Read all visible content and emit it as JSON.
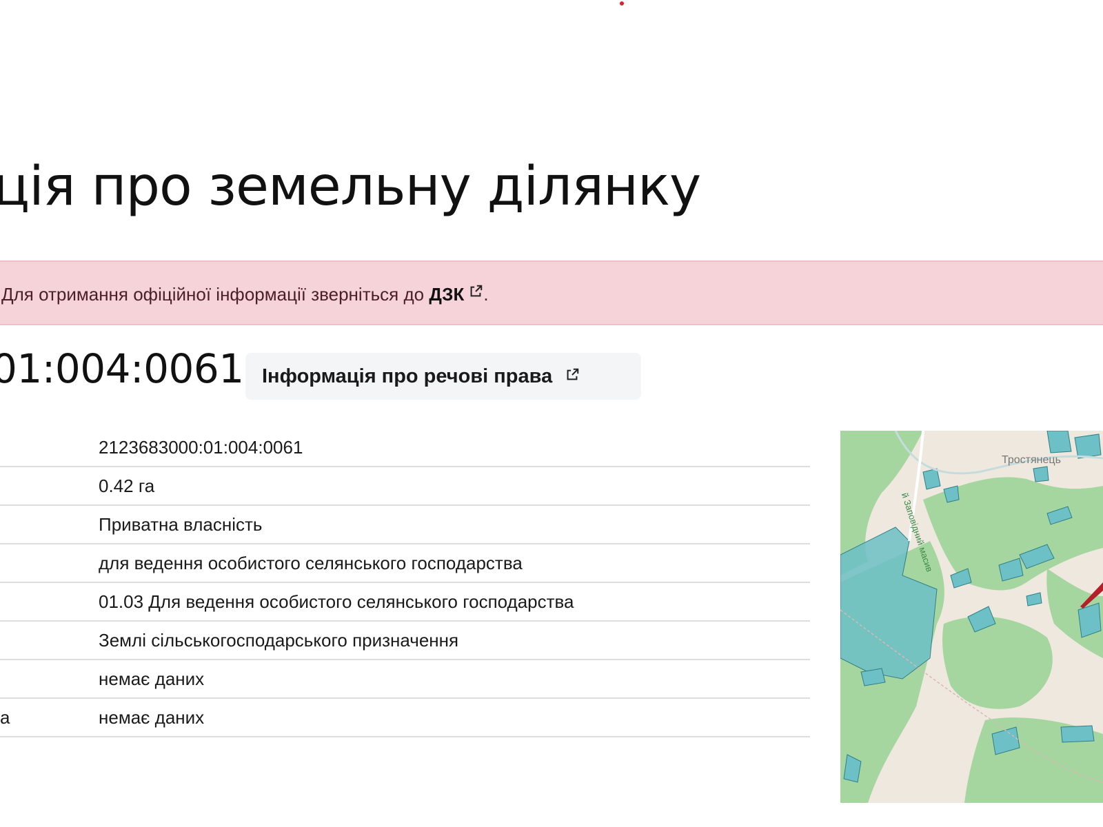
{
  "page": {
    "title": "ція про земельну ділянку"
  },
  "notice": {
    "text": "Для отримання офіційної інформації зверніться до ",
    "link_label": "ДЗК",
    "suffix": "."
  },
  "parcel": {
    "cadastral_number": "01:004:0061",
    "rights_button_label": "Інформація про речові права"
  },
  "details": {
    "rows": [
      {
        "key": "",
        "value": "2123683000:01:004:0061"
      },
      {
        "key": "",
        "value": "0.42 га"
      },
      {
        "key": "",
        "value": "Приватна власність"
      },
      {
        "key": "",
        "value": "для ведення особистого селянського господарства"
      },
      {
        "key": "",
        "value": "01.03 Для ведення особистого селянського господарства"
      },
      {
        "key": "",
        "value": "Землі сільськогосподарського призначення"
      },
      {
        "key": "",
        "value": "немає даних"
      },
      {
        "key": "а",
        "value": "немає даних"
      }
    ]
  },
  "map": {
    "place_label": "Тростянець",
    "road_label": "й Заповідний масив",
    "colors": {
      "background": "#efe8de",
      "forest": "#9fd49a",
      "parcel_fill": "#6cc0c6",
      "parcel_stroke": "#2f7f86",
      "highlight": "#b3202a"
    }
  },
  "icons": {
    "external_link": "external-link-icon"
  },
  "colors": {
    "notice_background": "#f6d3d8",
    "accent_red": "#e0202b",
    "button_background": "#f4f5f7"
  }
}
